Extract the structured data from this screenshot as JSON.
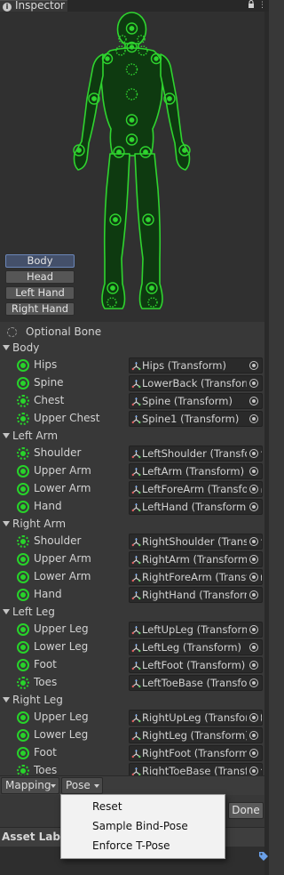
{
  "tab": {
    "title": "Inspector",
    "icon": "info-icon"
  },
  "icons": {
    "lock": "lock-icon",
    "menu": "more-menu-icon"
  },
  "colors": {
    "bone_green": "#27d32a",
    "avatar_fill": "#0e3a10",
    "active_part": "#44506a"
  },
  "body_parts": [
    {
      "label": "Body",
      "active": true
    },
    {
      "label": "Head",
      "active": false
    },
    {
      "label": "Left Hand",
      "active": false
    },
    {
      "label": "Right Hand",
      "active": false
    }
  ],
  "optional_bone_label": "Optional Bone",
  "groups": [
    {
      "label": "Body",
      "bones": [
        {
          "name": "Hips",
          "value": "Hips (Transform)",
          "optional": false
        },
        {
          "name": "Spine",
          "value": "LowerBack (Transform)",
          "optional": false
        },
        {
          "name": "Chest",
          "value": "Spine (Transform)",
          "optional": true
        },
        {
          "name": "Upper Chest",
          "value": "Spine1 (Transform)",
          "optional": true
        }
      ]
    },
    {
      "label": "Left Arm",
      "bones": [
        {
          "name": "Shoulder",
          "value": "LeftShoulder (Transform)",
          "optional": true
        },
        {
          "name": "Upper Arm",
          "value": "LeftArm (Transform)",
          "optional": false
        },
        {
          "name": "Lower Arm",
          "value": "LeftForeArm (Transform)",
          "optional": false
        },
        {
          "name": "Hand",
          "value": "LeftHand (Transform)",
          "optional": false
        }
      ]
    },
    {
      "label": "Right Arm",
      "bones": [
        {
          "name": "Shoulder",
          "value": "RightShoulder (Transform)",
          "optional": true
        },
        {
          "name": "Upper Arm",
          "value": "RightArm (Transform)",
          "optional": false
        },
        {
          "name": "Lower Arm",
          "value": "RightForeArm (Transform)",
          "optional": false
        },
        {
          "name": "Hand",
          "value": "RightHand (Transform)",
          "optional": false
        }
      ]
    },
    {
      "label": "Left Leg",
      "bones": [
        {
          "name": "Upper Leg",
          "value": "LeftUpLeg (Transform)",
          "optional": false
        },
        {
          "name": "Lower Leg",
          "value": "LeftLeg (Transform)",
          "optional": false
        },
        {
          "name": "Foot",
          "value": "LeftFoot (Transform)",
          "optional": false
        },
        {
          "name": "Toes",
          "value": "LeftToeBase (Transform)",
          "optional": true
        }
      ]
    },
    {
      "label": "Right Leg",
      "bones": [
        {
          "name": "Upper Leg",
          "value": "RightUpLeg (Transform)",
          "optional": false
        },
        {
          "name": "Lower Leg",
          "value": "RightLeg (Transform)",
          "optional": false
        },
        {
          "name": "Foot",
          "value": "RightFoot (Transform)",
          "optional": false
        },
        {
          "name": "Toes",
          "value": "RightToeBase (Transform)",
          "optional": true
        }
      ]
    }
  ],
  "bottom": {
    "mapping_label": "Mapping",
    "pose_label": "Pose",
    "done_label": "Done"
  },
  "asset_labels": "Asset Labels",
  "pose_menu": [
    "Reset",
    "Sample Bind-Pose",
    "Enforce T-Pose"
  ]
}
